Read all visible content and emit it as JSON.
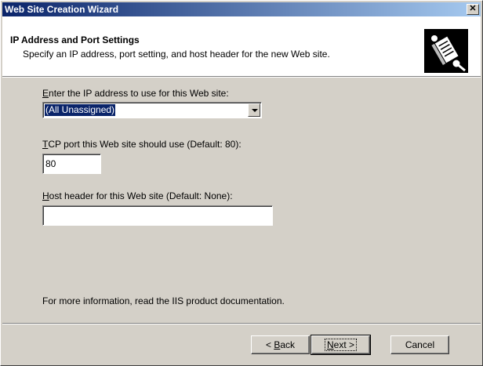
{
  "window": {
    "title": "Web Site Creation Wizard",
    "close_glyph": "✕"
  },
  "header": {
    "title": "IP Address and Port Settings",
    "subtitle": "Specify an IP address, port setting, and host header for the new Web site.",
    "icon": "wizard-book-icon"
  },
  "form": {
    "ip": {
      "label_hotkey": "E",
      "label_rest": "nter the IP address to use for this Web site:",
      "value": "(All Unassigned)"
    },
    "port": {
      "label_hotkey": "T",
      "label_rest": "CP port this Web site should use (Default: 80):",
      "value": "80"
    },
    "host": {
      "label_hotkey": "H",
      "label_rest": "ost header for this Web site (Default: None):",
      "value": ""
    },
    "info": "For more information, read the IIS product documentation."
  },
  "buttons": {
    "back": {
      "prefix": "< ",
      "hotkey": "B",
      "rest": "ack"
    },
    "next": {
      "hotkey": "N",
      "rest": "ext >"
    },
    "cancel": "Cancel"
  },
  "colors": {
    "titlebar_start": "#0a246a",
    "titlebar_end": "#a6caf0",
    "face": "#d4d0c8",
    "selection": "#0a246a"
  }
}
